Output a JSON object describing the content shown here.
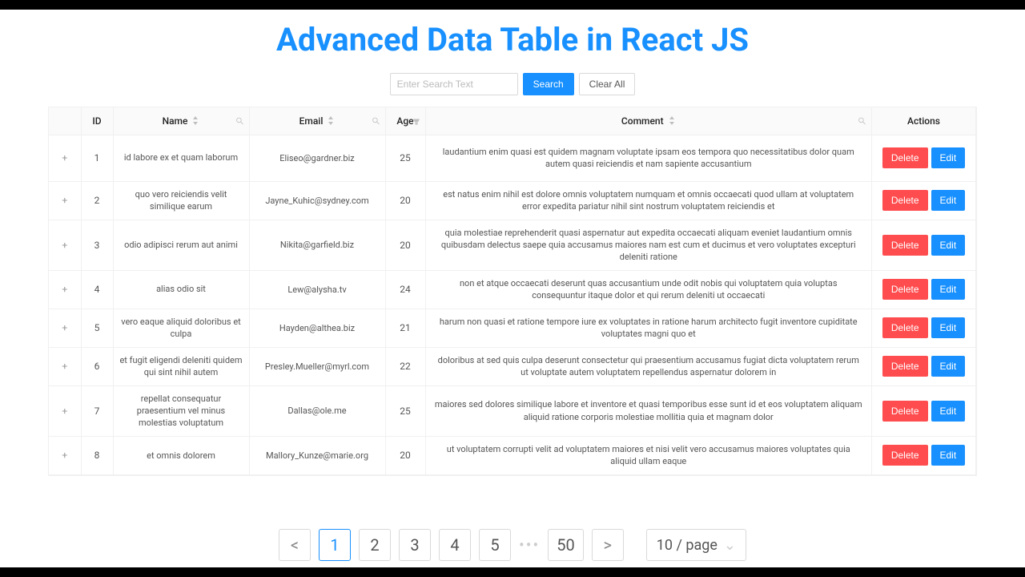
{
  "page_title": "Advanced Data Table in React JS",
  "search": {
    "placeholder": "Enter Search Text",
    "search_label": "Search",
    "clear_label": "Clear All"
  },
  "columns": {
    "expand": "",
    "id": "ID",
    "name": "Name",
    "email": "Email",
    "age": "Age",
    "comment": "Comment",
    "actions": "Actions"
  },
  "actions": {
    "delete": "Delete",
    "edit": "Edit"
  },
  "rows": [
    {
      "id": "1",
      "name": "id labore ex et quam laborum",
      "email": "Eliseo@gardner.biz",
      "age": "25",
      "comment": "laudantium enim quasi est quidem magnam voluptate ipsam eos tempora quo necessitatibus dolor quam autem quasi reiciendis et nam sapiente accusantium"
    },
    {
      "id": "2",
      "name": "quo vero reiciendis velit similique earum",
      "email": "Jayne_Kuhic@sydney.com",
      "age": "20",
      "comment": "est natus enim nihil est dolore omnis voluptatem numquam et omnis occaecati quod ullam at voluptatem error expedita pariatur nihil sint nostrum voluptatem reiciendis et"
    },
    {
      "id": "3",
      "name": "odio adipisci rerum aut animi",
      "email": "Nikita@garfield.biz",
      "age": "20",
      "comment": "quia molestiae reprehenderit quasi aspernatur aut expedita occaecati aliquam eveniet laudantium omnis quibusdam delectus saepe quia accusamus maiores nam est cum et ducimus et vero voluptates excepturi deleniti ratione"
    },
    {
      "id": "4",
      "name": "alias odio sit",
      "email": "Lew@alysha.tv",
      "age": "24",
      "comment": "non et atque occaecati deserunt quas accusantium unde odit nobis qui voluptatem quia voluptas consequuntur itaque dolor et qui rerum deleniti ut occaecati"
    },
    {
      "id": "5",
      "name": "vero eaque aliquid doloribus et culpa",
      "email": "Hayden@althea.biz",
      "age": "21",
      "comment": "harum non quasi et ratione tempore iure ex voluptates in ratione harum architecto fugit inventore cupiditate voluptates magni quo et"
    },
    {
      "id": "6",
      "name": "et fugit eligendi deleniti quidem qui sint nihil autem",
      "email": "Presley.Mueller@myrl.com",
      "age": "22",
      "comment": "doloribus at sed quis culpa deserunt consectetur qui praesentium accusamus fugiat dicta voluptatem rerum ut voluptate autem voluptatem repellendus aspernatur dolorem in"
    },
    {
      "id": "7",
      "name": "repellat consequatur praesentium vel minus molestias voluptatum",
      "email": "Dallas@ole.me",
      "age": "25",
      "comment": "maiores sed dolores similique labore et inventore et quasi temporibus esse sunt id et eos voluptatem aliquam aliquid ratione corporis molestiae mollitia quia et magnam dolor"
    },
    {
      "id": "8",
      "name": "et omnis dolorem",
      "email": "Mallory_Kunze@marie.org",
      "age": "20",
      "comment": "ut voluptatem corrupti velit ad voluptatem maiores et nisi velit vero accusamus maiores voluptates quia aliquid ullam eaque"
    }
  ],
  "pagination": {
    "prev": "<",
    "next": ">",
    "pages": [
      "1",
      "2",
      "3",
      "4",
      "5"
    ],
    "last": "50",
    "size": "10 / page",
    "dots": "•••"
  }
}
